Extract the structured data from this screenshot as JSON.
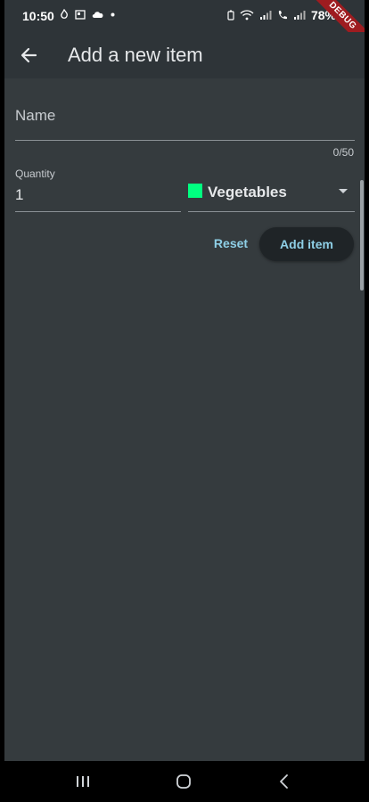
{
  "status_bar": {
    "time": "10:50",
    "battery": "78%",
    "debug_banner": "DEBUG"
  },
  "app_bar": {
    "title": "Add a new item"
  },
  "form": {
    "name": {
      "label": "Name",
      "value": "",
      "counter": "0/50"
    },
    "quantity": {
      "label": "Quantity",
      "value": "1"
    },
    "category": {
      "value": "Vegetables",
      "swatch_color": "#00ff80"
    }
  },
  "actions": {
    "reset_label": "Reset",
    "add_label": "Add item"
  },
  "icons": {
    "back": "arrow-left-icon",
    "nav_recents": "recents-icon",
    "nav_home": "home-icon",
    "nav_back": "chevron-left-icon"
  },
  "colors": {
    "background": "#353b3e",
    "app_bar": "#2e3438",
    "accent": "#8ecfe6",
    "button_bg": "#1f2427"
  }
}
